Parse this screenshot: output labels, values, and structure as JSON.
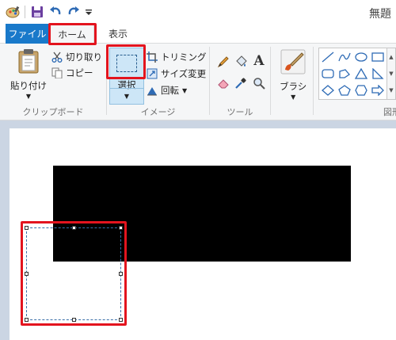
{
  "window": {
    "title": "無題"
  },
  "quick_access": {
    "icons": [
      "paint-app-icon",
      "save-icon",
      "undo-icon",
      "redo-icon",
      "customize-qat-icon"
    ]
  },
  "tabs": {
    "file": "ファイル",
    "home": "ホーム",
    "view": "表示"
  },
  "ribbon": {
    "clipboard": {
      "paste": "貼り付け",
      "cut": "切り取り",
      "copy": "コピー",
      "group_label": "クリップボード"
    },
    "image": {
      "select": "選択",
      "crop": "トリミング",
      "resize": "サイズ変更",
      "rotate": "回転",
      "group_label": "イメージ"
    },
    "tools": {
      "group_label": "ツール",
      "text_tool": "A"
    },
    "brushes": {
      "label": "ブラシ"
    },
    "shapes": {
      "group_label": "図形"
    }
  },
  "colors": {
    "file_tab": "#1979ca",
    "selected_button": "#cde6f7",
    "highlight": "#e3141e",
    "canvas_bg": "#cbd5e3",
    "drawn_rect": "#000000"
  }
}
